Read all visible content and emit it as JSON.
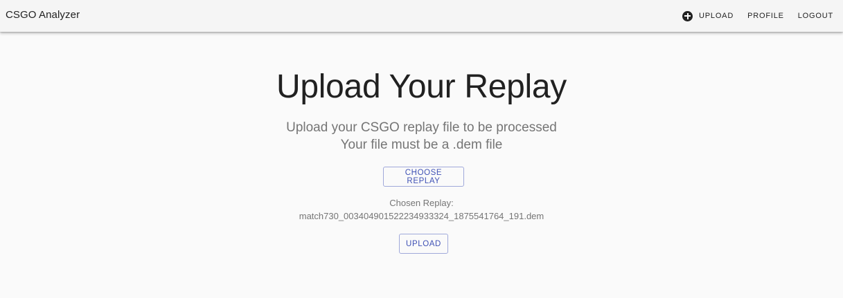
{
  "appbar": {
    "brand": "CSGO Analyzer",
    "nav": {
      "upload_icon": "add-circle-icon",
      "upload_label": "UPLOAD",
      "profile_label": "PROFILE",
      "logout_label": "LOGOUT"
    }
  },
  "main": {
    "title": "Upload Your Replay",
    "subtitle_line1": "Upload your CSGO replay file to be processed",
    "subtitle_line2": "Your file must be a .dem file",
    "choose_button_label": "CHOOSE REPLAY",
    "chosen_label": "Chosen Replay:",
    "chosen_filename": "match730_003404901522234933324_1875541764_191.dem",
    "upload_button_label": "UPLOAD"
  },
  "colors": {
    "accent": "#3f51b5",
    "accent_border": "#9fa8da",
    "background": "#fafafa",
    "appbar": "#f5f5f5",
    "muted_text": "#757575"
  }
}
